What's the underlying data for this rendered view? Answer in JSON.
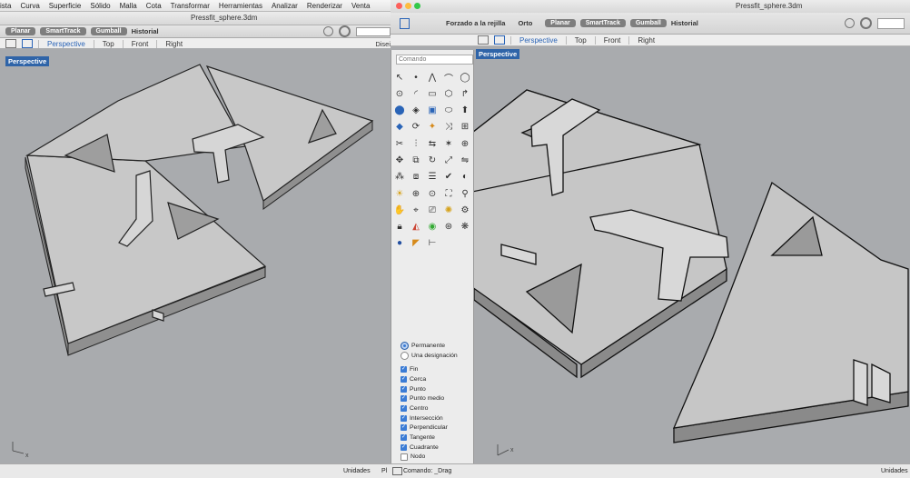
{
  "menubar": {
    "items": [
      "ista",
      "Curva",
      "Superficie",
      "Sólido",
      "Malla",
      "Cota",
      "Transformar",
      "Herramientas",
      "Analizar",
      "Renderizar",
      "Venta"
    ]
  },
  "left_window": {
    "title": "Pressfit_sphere.3dm",
    "toolbar": {
      "planar": "Planar",
      "smarttrack": "SmartTrack",
      "gumball": "Gumball",
      "history": "Historial"
    },
    "tabs": [
      "Perspective",
      "Top",
      "Front",
      "Right"
    ],
    "active_tab": "Perspective",
    "viewport_label": "Perspective",
    "disp_text": "Disei",
    "axes": {
      "x": "x",
      "y": "y"
    }
  },
  "right_window": {
    "title": "Pressfit_sphere.3dm",
    "toolbar": {
      "snap_grid": "Forzado a la rejilla",
      "ortho": "Orto",
      "planar": "Planar",
      "smarttrack": "SmartTrack",
      "gumball": "Gumball",
      "history": "Historial"
    },
    "tabs": [
      "Perspective",
      "Top",
      "Front",
      "Right"
    ],
    "active_tab": "Perspective",
    "viewport_label": "Perspective",
    "axes": {
      "x": "x",
      "y": "y"
    }
  },
  "panel": {
    "command_placeholder": "Comando",
    "osnap_mode": [
      {
        "label": "Permanente",
        "selected": true
      },
      {
        "label": "Una designación",
        "selected": false
      }
    ],
    "osnaps": [
      {
        "label": "Fin",
        "checked": true
      },
      {
        "label": "Cerca",
        "checked": true
      },
      {
        "label": "Punto",
        "checked": true
      },
      {
        "label": "Punto medio",
        "checked": true
      },
      {
        "label": "Centro",
        "checked": true
      },
      {
        "label": "Intersección",
        "checked": true
      },
      {
        "label": "Perpendicular",
        "checked": true
      },
      {
        "label": "Tangente",
        "checked": true
      },
      {
        "label": "Cuadrante",
        "checked": true
      },
      {
        "label": "Nodo",
        "checked": false
      }
    ]
  },
  "status": {
    "units_left": "Unidades",
    "pl": "Pl",
    "command_status": "Comando: _Drag",
    "units_right": "Unidades"
  },
  "colors": {
    "accent": "#2f64a8",
    "viewport_bg": "#a9abae",
    "part_fill": "#c9c9c9"
  }
}
